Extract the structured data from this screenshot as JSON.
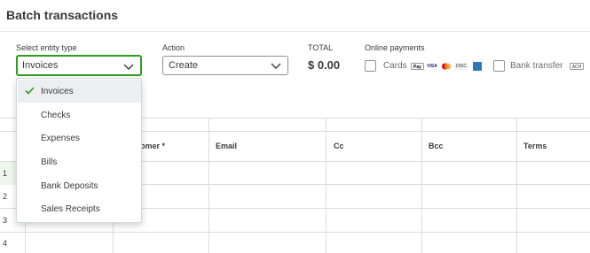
{
  "header": {
    "title": "Batch transactions"
  },
  "controls": {
    "entity_type_label": "Select entity type",
    "entity_type_value": "Invoices",
    "action_label": "Action",
    "action_value": "Create",
    "total_label": "TOTAL",
    "total_value": "$ 0.00",
    "online_payments_label": "Online payments",
    "cards_label": "Cards",
    "bank_transfer_label": "Bank transfer"
  },
  "grid": {
    "columns": [
      "omer *",
      "Email",
      "Cc",
      "Bcc",
      "Terms"
    ],
    "row_numbers": [
      "1",
      "2",
      "3",
      "4"
    ]
  },
  "dropdown": {
    "options": [
      "Invoices",
      "Checks",
      "Expenses",
      "Bills",
      "Bank Deposits",
      "Sales Receipts"
    ],
    "selected": "Invoices"
  },
  "icons": {
    "select_chevron": "chevron-down-icon",
    "option_check": "check-icon",
    "card_logos": [
      "apple-pay-icon",
      "visa-icon",
      "mastercard-icon",
      "discover-icon",
      "amex-icon"
    ],
    "bank_logo": "ach-icon"
  },
  "colors": {
    "accent_green": "#2ca01c",
    "text": "#393a3d",
    "selected_option_bg": "#eceef1",
    "selected_row_bg": "#eef7ec"
  }
}
